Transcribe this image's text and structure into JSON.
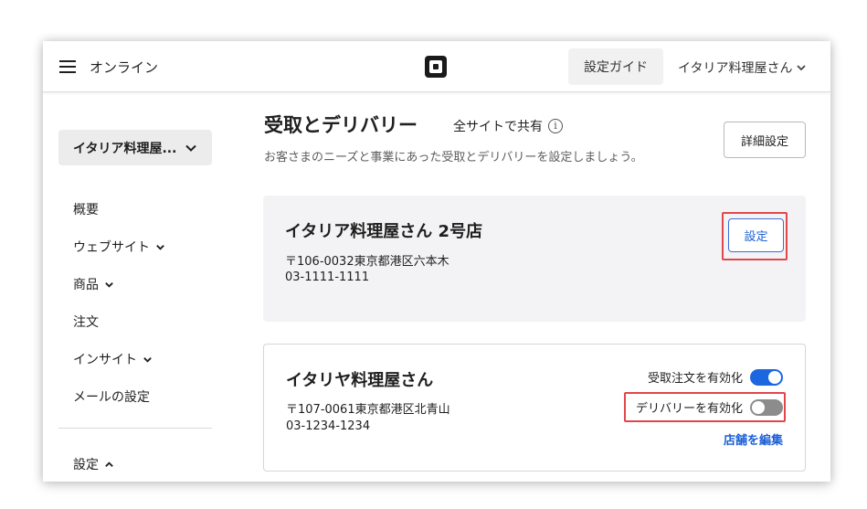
{
  "topbar": {
    "app_title": "オンライン",
    "guide_button": "設定ガイド",
    "account_label": "イタリア料理屋さん"
  },
  "sidebar": {
    "store_select": "イタリア料理屋...",
    "items": [
      {
        "label": "概要",
        "has_chevron": false
      },
      {
        "label": "ウェブサイト",
        "has_chevron": true
      },
      {
        "label": "商品",
        "has_chevron": true
      },
      {
        "label": "注文",
        "has_chevron": false
      },
      {
        "label": "インサイト",
        "has_chevron": true
      },
      {
        "label": "メールの設定",
        "has_chevron": false
      }
    ],
    "settings_label": "設定"
  },
  "main": {
    "title": "受取とデリバリー",
    "share_label": "全サイトで共有",
    "subtitle": "お客さまのニーズと事業にあった受取とデリバリーを設定しましょう。",
    "detail_button": "詳細設定",
    "stores": [
      {
        "name": "イタリア料理屋さん 2号店",
        "address": "〒106-0032東京都港区六本木",
        "phone": "03-1111-1111",
        "setup_button": "設定"
      },
      {
        "name": "イタリヤ料理屋さん",
        "address": "〒107-0061東京都港区北青山",
        "phone": "03-1234-1234",
        "pickup_toggle_label": "受取注文を有効化",
        "pickup_enabled": true,
        "delivery_toggle_label": "デリバリーを有効化",
        "delivery_enabled": false,
        "edit_link": "店舗を編集"
      }
    ]
  },
  "colors": {
    "accent_blue": "#1c66e0",
    "link_blue": "#1c5fd6",
    "highlight_red": "#e0474c",
    "toggle_off": "#8c8c8c"
  },
  "icons": {
    "menu": "hamburger-menu-icon",
    "logo": "square-logo-icon",
    "dropdown": "chevron-down-icon",
    "info": "info-icon",
    "collapse": "chevron-up-icon"
  }
}
